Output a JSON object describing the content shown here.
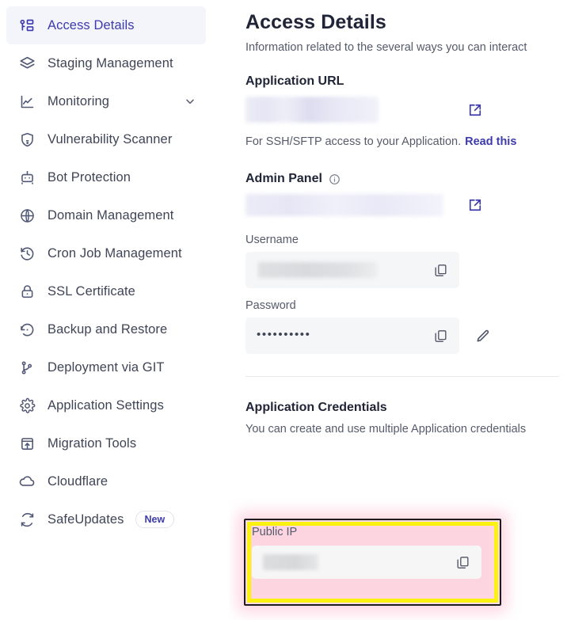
{
  "sidebar": {
    "items": [
      {
        "label": "Access Details",
        "icon": "key-list-icon",
        "active": true,
        "chevron": false,
        "badge": null
      },
      {
        "label": "Staging Management",
        "icon": "layers-icon",
        "active": false,
        "chevron": false,
        "badge": null
      },
      {
        "label": "Monitoring",
        "icon": "chart-line-icon",
        "active": false,
        "chevron": true,
        "badge": null
      },
      {
        "label": "Vulnerability Scanner",
        "icon": "shield-alert-icon",
        "active": false,
        "chevron": false,
        "badge": null
      },
      {
        "label": "Bot Protection",
        "icon": "robot-icon",
        "active": false,
        "chevron": false,
        "badge": null
      },
      {
        "label": "Domain Management",
        "icon": "www-globe-icon",
        "active": false,
        "chevron": false,
        "badge": null
      },
      {
        "label": "Cron Job Management",
        "icon": "clock-history-icon",
        "active": false,
        "chevron": false,
        "badge": null
      },
      {
        "label": "SSL Certificate",
        "icon": "lock-icon",
        "active": false,
        "chevron": false,
        "badge": null
      },
      {
        "label": "Backup and Restore",
        "icon": "restore-icon",
        "active": false,
        "chevron": false,
        "badge": null
      },
      {
        "label": "Deployment via GIT",
        "icon": "git-branch-icon",
        "active": false,
        "chevron": false,
        "badge": null
      },
      {
        "label": "Application Settings",
        "icon": "gear-icon",
        "active": false,
        "chevron": false,
        "badge": null
      },
      {
        "label": "Migration Tools",
        "icon": "upload-box-icon",
        "active": false,
        "chevron": false,
        "badge": null
      },
      {
        "label": "Cloudflare",
        "icon": "cloud-icon",
        "active": false,
        "chevron": false,
        "badge": null
      },
      {
        "label": "SafeUpdates",
        "icon": "refresh-icon",
        "active": false,
        "chevron": false,
        "badge": "New"
      }
    ]
  },
  "main": {
    "title": "Access Details",
    "subtitle": "Information related to the several ways you can interact",
    "application_url": {
      "heading": "Application URL",
      "value": "",
      "open_icon": "external-link-icon",
      "hint_text": "For SSH/SFTP access to your Application.",
      "hint_link": "Read this"
    },
    "admin_panel": {
      "heading": "Admin Panel",
      "info_icon": "info-circle-icon",
      "url_value": "",
      "open_icon": "external-link-icon",
      "username_label": "Username",
      "username_value": "",
      "password_label": "Password",
      "password_value": "••••••••••",
      "copy_icon": "copy-icon",
      "edit_icon": "pencil-icon"
    },
    "application_credentials": {
      "heading": "Application Credentials",
      "subtitle": "You can create and use multiple Application credentials",
      "public_ip_label": "Public IP",
      "public_ip_value": "",
      "copy_icon": "copy-icon"
    }
  },
  "colors": {
    "accent": "#3d3bad",
    "text_dark": "#1f2437",
    "text_muted": "#555b6b",
    "active_bg": "#f4f4fb",
    "highlight_yellow": "#fbf211",
    "highlight_glow": "#fdd3e0",
    "field_bg": "#f5f6f7"
  }
}
